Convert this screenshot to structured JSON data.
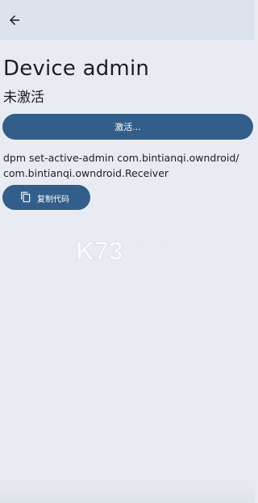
{
  "app_bar": {
    "back_icon": "arrow-left-icon"
  },
  "title": "Device admin",
  "status": "未激活",
  "activate_button_label": "激活...",
  "command_text": "dpm set-active-admin com.bintianqi.owndroid/\ncom.bintianqi.owndroid.Receiver",
  "copy_button": {
    "icon": "copy-icon",
    "label": "复制代码"
  },
  "watermark": {
    "brand": "K73",
    "line1": "游戏之家",
    "line2": ".com"
  },
  "colors": {
    "background": "#e8ecf2",
    "app_bar": "#dde3ec",
    "primary_button": "#335e89",
    "button_text": "#ffffff"
  }
}
